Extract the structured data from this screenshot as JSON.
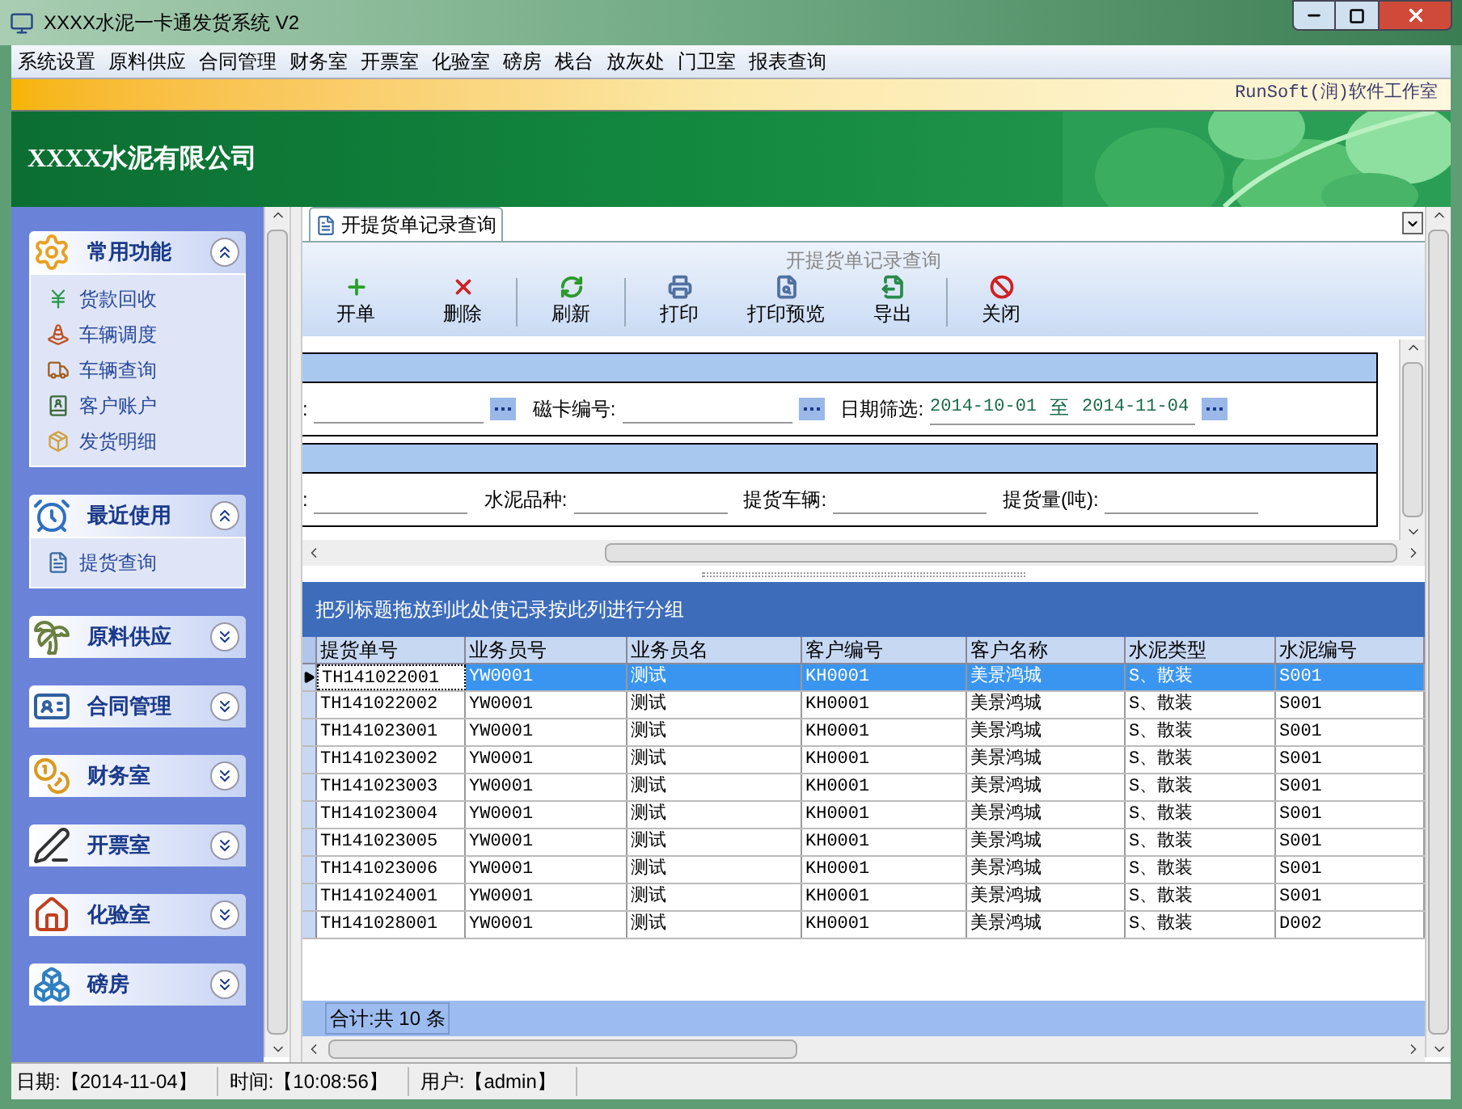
{
  "window": {
    "title": "XXXX水泥一卡通发货系统 V2"
  },
  "menu": [
    "系统设置",
    "原料供应",
    "合同管理",
    "财务室",
    "开票室",
    "化验室",
    "磅房",
    "栈台",
    "放灰处",
    "门卫室",
    "报表查询"
  ],
  "brand_bar": {
    "text": "RunSoft(润)软件工作室"
  },
  "banner": {
    "company": "XXXX水泥有限公司"
  },
  "sidebar": {
    "groups": [
      {
        "title": "常用功能",
        "expanded": true,
        "items": [
          "货款回收",
          "车辆调度",
          "车辆查询",
          "客户账户",
          "发货明细"
        ]
      },
      {
        "title": "最近使用",
        "expanded": true,
        "items": [
          "提货查询"
        ]
      },
      {
        "title": "原料供应",
        "expanded": false
      },
      {
        "title": "合同管理",
        "expanded": false
      },
      {
        "title": "财务室",
        "expanded": false
      },
      {
        "title": "开票室",
        "expanded": false
      },
      {
        "title": "化验室",
        "expanded": false
      },
      {
        "title": "磅房",
        "expanded": false
      }
    ]
  },
  "tabs": [
    {
      "label": "开提货单记录查询",
      "selected": true
    }
  ],
  "toolbar": {
    "title": "开提货单记录查询",
    "buttons": [
      "开单",
      "删除",
      "刷新",
      "打印",
      "打印预览",
      "导出",
      "关闭"
    ]
  },
  "filters": [
    {
      "fields": [
        {
          "kind": "lookup",
          "label": ":"
        },
        {
          "kind": "lookup",
          "label": "磁卡编号:"
        },
        {
          "kind": "date_range",
          "label": "日期筛选:",
          "from": "2014-10-01",
          "sep": "至",
          "to": "2014-11-04"
        }
      ]
    },
    {
      "fields": [
        {
          "kind": "text",
          "label": ":"
        },
        {
          "kind": "text",
          "label": "水泥品种:"
        },
        {
          "kind": "text",
          "label": "提货车辆:"
        },
        {
          "kind": "text",
          "label": "提货量(吨):"
        }
      ]
    }
  ],
  "group_panel": {
    "hint": "把列标题拖放到此处使记录按此列进行分组"
  },
  "table": {
    "columns": [
      "提货单号",
      "业务员号",
      "业务员名",
      "客户编号",
      "客户名称",
      "水泥类型",
      "水泥编号"
    ],
    "rows": [
      {
        "selected": true,
        "cells": [
          "TH141022001",
          "YW0001",
          "测试",
          "KH0001",
          "美景鸿城",
          "S、散装",
          "S001"
        ]
      },
      {
        "selected": false,
        "cells": [
          "TH141022002",
          "YW0001",
          "测试",
          "KH0001",
          "美景鸿城",
          "S、散装",
          "S001"
        ]
      },
      {
        "selected": false,
        "cells": [
          "TH141023001",
          "YW0001",
          "测试",
          "KH0001",
          "美景鸿城",
          "S、散装",
          "S001"
        ]
      },
      {
        "selected": false,
        "cells": [
          "TH141023002",
          "YW0001",
          "测试",
          "KH0001",
          "美景鸿城",
          "S、散装",
          "S001"
        ]
      },
      {
        "selected": false,
        "cells": [
          "TH141023003",
          "YW0001",
          "测试",
          "KH0001",
          "美景鸿城",
          "S、散装",
          "S001"
        ]
      },
      {
        "selected": false,
        "cells": [
          "TH141023004",
          "YW0001",
          "测试",
          "KH0001",
          "美景鸿城",
          "S、散装",
          "S001"
        ]
      },
      {
        "selected": false,
        "cells": [
          "TH141023005",
          "YW0001",
          "测试",
          "KH0001",
          "美景鸿城",
          "S、散装",
          "S001"
        ]
      },
      {
        "selected": false,
        "cells": [
          "TH141023006",
          "YW0001",
          "测试",
          "KH0001",
          "美景鸿城",
          "S、散装",
          "S001"
        ]
      },
      {
        "selected": false,
        "cells": [
          "TH141024001",
          "YW0001",
          "测试",
          "KH0001",
          "美景鸿城",
          "S、散装",
          "S001"
        ]
      },
      {
        "selected": false,
        "cells": [
          "TH141028001",
          "YW0001",
          "测试",
          "KH0001",
          "美景鸿城",
          "S、散装",
          "D002"
        ]
      }
    ]
  },
  "footer": {
    "summary": "合计:共 10 条"
  },
  "status_bar": [
    "日期:【2014-11-04】",
    "时间:【10:08:56】",
    "用户:【admin】"
  ]
}
